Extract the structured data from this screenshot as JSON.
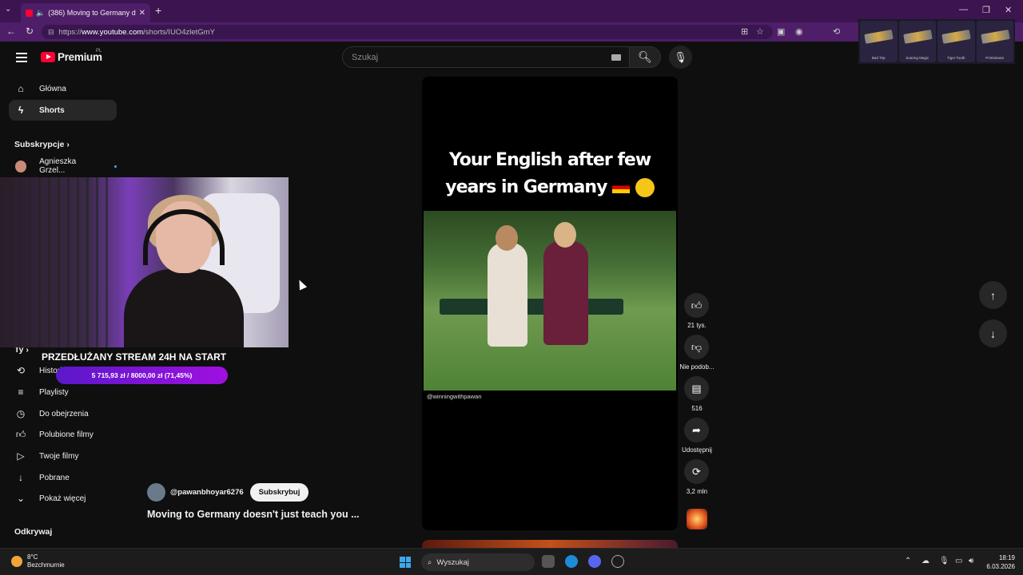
{
  "browser": {
    "tab_title": "(386) Moving to Germany do...",
    "tab_close": "✕",
    "new_tab": "+",
    "url_prefix": "https://",
    "url_host": "www.youtube.com",
    "url_path": "/shorts/IUO4zletGmY",
    "window_controls": [
      "—",
      "❐",
      "✕"
    ],
    "overlay_skins": [
      "Bad Trip",
      "Soaring Magic",
      "Tiger Tooth",
      "Printstream"
    ]
  },
  "youtube": {
    "logo_text": "Premium",
    "logo_region": "PL",
    "search_placeholder": "Szukaj"
  },
  "sidebar": {
    "items": [
      {
        "label": "Główna",
        "icon": "home-icon"
      },
      {
        "label": "Shorts",
        "icon": "shorts-icon"
      }
    ],
    "subscriptions_header": "Subskrypcje",
    "subscription_channel": "Agnieszka Grzel...",
    "you_header": "Ty",
    "you_items": [
      {
        "label": "Historia",
        "icon": "history-icon"
      },
      {
        "label": "Playlisty",
        "icon": "playlist-icon"
      },
      {
        "label": "Do obejrzenia",
        "icon": "watch-later-icon"
      },
      {
        "label": "Polubione filmy",
        "icon": "like-icon"
      },
      {
        "label": "Twoje filmy",
        "icon": "video-icon"
      },
      {
        "label": "Pobrane",
        "icon": "download-icon"
      },
      {
        "label": "Pokaż więcej",
        "icon": "chevron-down-icon"
      }
    ],
    "explore_header": "Odkrywaj"
  },
  "stream_overlay": {
    "title": "PRZEDŁUŻANY STREAM 24H NA START",
    "donation_text": "5 715,93 zł  /  8000,00 zł (71,45%)",
    "donation_progress": 0.7145
  },
  "short": {
    "caption_line1": "Your English after few",
    "caption_line2": "years in Germany",
    "watermark": "@winningwithpawan",
    "channel": "@pawanbhoyar6276",
    "subscribe_label": "Subskrybuj",
    "title": "Moving to Germany doesn't just teach you ..."
  },
  "actions": {
    "likes": "21 tys.",
    "dislike_label": "Nie podob...",
    "comments": "516",
    "share_label": "Udostępnij",
    "remix_count": "3,2 mln"
  },
  "taskbar": {
    "temperature": "8°C",
    "weather": "Bezchmurnie",
    "search_label": "Wyszukaj",
    "time": "18:19",
    "date": "6.03.2026"
  },
  "colors": {
    "browser_frame": "#4e1e68",
    "yt_red": "#ff0033",
    "donation_bar": "#a010e0"
  }
}
